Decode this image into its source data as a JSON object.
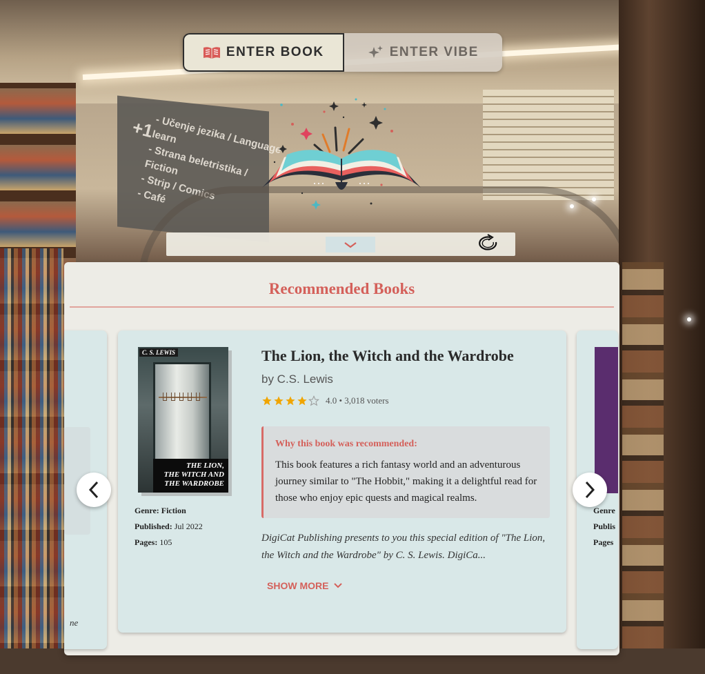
{
  "toggle": {
    "book_label": "ENTER BOOK",
    "vibe_label": "ENTER VIBE",
    "active": "book"
  },
  "background": {
    "sign_lines": [
      "- Učenje jezika / Language learn",
      "- Strana beletristika / Fiction",
      "- Strip / Comics",
      "- Café"
    ],
    "sign_prefix": "+1"
  },
  "panel": {
    "title": "Recommended Books"
  },
  "book": {
    "title": "The Lion, the Witch and the Wardrobe",
    "author": "by C.S. Lewis",
    "rating": 4.0,
    "rating_text": "4.0 • 3,018 voters",
    "cover_author": "C. S. LEWIS",
    "cover_title_lines": [
      "THE LION,",
      "THE WITCH AND",
      "THE WARDROBE"
    ],
    "genre_label": "Genre:",
    "genre": "Fiction",
    "published_label": "Published:",
    "published": "Jul 2022",
    "pages_label": "Pages:",
    "pages": "105",
    "why_heading": "Why this book was recommended:",
    "why_text": "This book features a rich fantasy world and an adventurous journey similar to \"The Hobbit,\" making it a delightful read for those who enjoy epic quests and magical realms.",
    "description": "DigiCat Publishing presents to you this special edition of \"The Lion, the Witch and the Wardrobe\" by C. S. Lewis. DigiCa...",
    "show_more": "SHOW MORE"
  },
  "peek_left": {
    "text": "ne"
  },
  "peek_right": {
    "genre_label": "Genre",
    "published_label": "Publis",
    "pages_label": "Pages"
  },
  "colors": {
    "accent": "#d4605a",
    "card_bg": "#d9e8e8",
    "panel_bg": "#edece6",
    "star": "#f0a500"
  },
  "icons": {
    "book_tab": "open-book-icon",
    "vibe_tab": "sparkles-icon",
    "collapse": "chevron-down-icon",
    "refresh": "refresh-icon",
    "prev": "chevron-left-icon",
    "next": "chevron-right-icon",
    "show_more": "chevron-down-icon"
  }
}
